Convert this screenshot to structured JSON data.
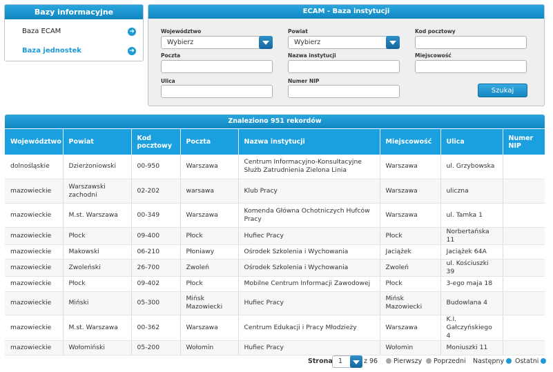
{
  "sidebar": {
    "title": "Bazy informacyjne",
    "items": [
      {
        "label": "Baza ECAM"
      },
      {
        "label": "Baza jednostek"
      }
    ]
  },
  "search": {
    "title": "ECAM - Baza instytucji",
    "fields": {
      "wojewodztwo": {
        "label": "Województwo",
        "value": "Wybierz"
      },
      "powiat": {
        "label": "Powiat",
        "value": "Wybierz"
      },
      "kod": {
        "label": "Kod pocztowy",
        "value": ""
      },
      "poczta": {
        "label": "Poczta",
        "value": ""
      },
      "nazwa": {
        "label": "Nazwa instytucji",
        "value": ""
      },
      "miejscowosc": {
        "label": "Miejscowość",
        "value": ""
      },
      "ulica": {
        "label": "Ulica",
        "value": ""
      },
      "nip": {
        "label": "Numer NIP",
        "value": ""
      }
    },
    "button": "Szukaj"
  },
  "results": {
    "summary": "Znaleziono 951 rekordów",
    "columns": [
      "Województwo",
      "Powiat",
      "Kod pocztowy",
      "Poczta",
      "Nazwa instytucji",
      "Miejscowość",
      "Ulica",
      "Numer NIP"
    ],
    "rows": [
      [
        "dolnośląskie",
        "Dzierżoniowski",
        "00-950",
        "Warszawa",
        "Centrum Informacyjno-Konsultacyjne Służb Zatrudnienia Zielona Linia",
        "Warszawa",
        "ul. Grzybowska",
        ""
      ],
      [
        "mazowieckie",
        "Warszawski zachodni",
        "02-202",
        "warsawa",
        "Klub Pracy",
        "Warszawa",
        "uliczna",
        ""
      ],
      [
        "mazowieckie",
        "M.st. Warszawa",
        "00-349",
        "Warszawa",
        "Komenda Główna Ochotniczych Hufców Pracy",
        "Warszawa",
        "ul. Tamka 1",
        ""
      ],
      [
        "mazowieckie",
        "Płock",
        "09-400",
        "Płock",
        "Hufiec Pracy",
        "Płock",
        "Norbertańska 11",
        ""
      ],
      [
        "mazowieckie",
        "Makowski",
        "06-210",
        "Płoniawy",
        "Ośrodek Szkolenia i Wychowania",
        "Jaciążek",
        "Jaciążek 64A",
        ""
      ],
      [
        "mazowieckie",
        "Zwoleński",
        "26-700",
        "Zwoleń",
        "Ośrodek Szkolenia i Wychowania",
        "Zwoleń",
        "ul. Kościuszki 39",
        ""
      ],
      [
        "mazowieckie",
        "Płock",
        "09-402",
        "Płock",
        "Mobilne Centrum Informacji Zawodowej",
        "Płock",
        "3-ego maja 18",
        ""
      ],
      [
        "mazowieckie",
        "Miński",
        "05-300",
        "Mińsk Mazowiecki",
        "Hufiec Pracy",
        "Mińsk Mazowiecki",
        "Budowlana 4",
        ""
      ],
      [
        "mazowieckie",
        "M.st. Warszawa",
        "00-362",
        "Warszawa",
        "Centrum Edukacji i Pracy Młodzieży",
        "Warszawa",
        "K.I. Gałczyńskiego 4",
        ""
      ],
      [
        "mazowieckie",
        "Wołomiński",
        "05-200",
        "Wołomin",
        "Hufiec Pracy",
        "Wołomin",
        "Moniuszki 11",
        ""
      ]
    ]
  },
  "pagination": {
    "label": "Strona",
    "current": "1",
    "total": "z 96",
    "first": "Pierwszy",
    "prev": "Poprzedni",
    "next": "Następny",
    "last": "Ostatni"
  },
  "icons": {
    "sidebar_arrow": "arrow-right-circle-icon",
    "select_dropdown": "chevron-down-icon",
    "pager_bullet": "circle-icon"
  },
  "colors": {
    "accent": "#1b9ad6",
    "header": "#1aa0de"
  }
}
